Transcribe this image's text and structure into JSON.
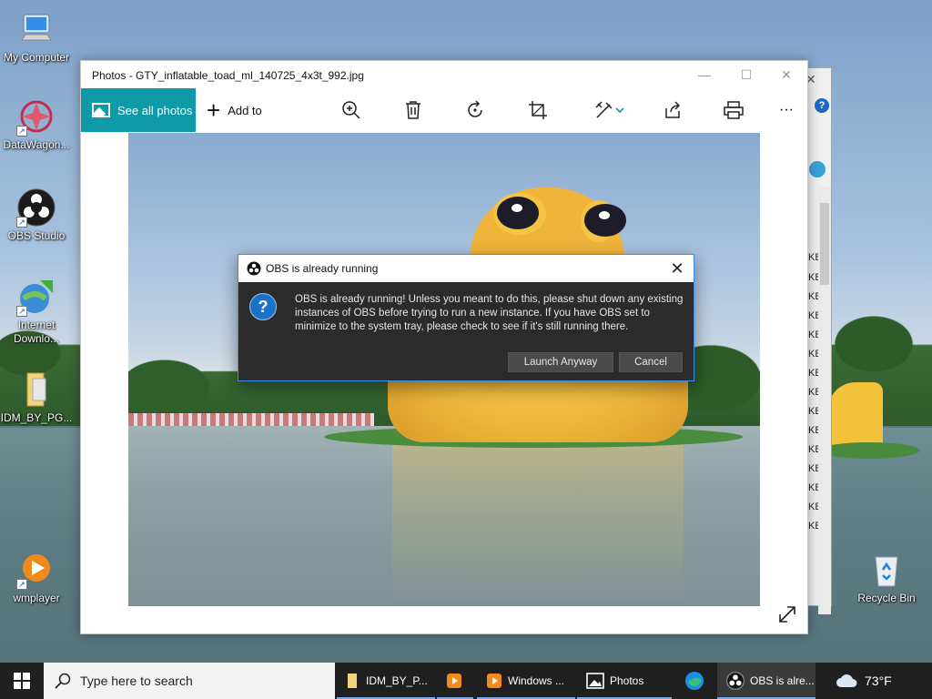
{
  "desktop": {
    "icons": [
      {
        "id": "my-computer",
        "label": "My Computer"
      },
      {
        "id": "datawagon",
        "label": "DataWagon..."
      },
      {
        "id": "obs-studio",
        "label": "OBS Studio"
      },
      {
        "id": "internet-download",
        "label": "Internet Downlo..."
      },
      {
        "id": "idm-folder",
        "label": "IDM_BY_PG..."
      },
      {
        "id": "wmplayer",
        "label": "wmplayer"
      },
      {
        "id": "recycle-bin",
        "label": "Recycle Bin"
      }
    ]
  },
  "back_window": {
    "help_label": "?",
    "size_unit": "KB"
  },
  "photos": {
    "title": "Photos - GTY_inflatable_toad_ml_140725_4x3t_992.jpg",
    "see_all_label": "See all photos",
    "add_to_label": "Add to",
    "toolbar_icons": [
      "zoom-in-icon",
      "delete-icon",
      "rotate-icon",
      "crop-icon",
      "edit-icon",
      "share-icon",
      "print-icon",
      "more-icon"
    ],
    "more_label": "···"
  },
  "dialog": {
    "title": "OBS is already running",
    "message": "OBS is already running! Unless you meant to do this, please shut down any existing instances of OBS before trying to run a new instance. If you have OBS set to minimize to the system tray, please check to see if it's still running there.",
    "icon_label": "?",
    "launch_label": "Launch Anyway",
    "cancel_label": "Cancel"
  },
  "taskbar": {
    "search_placeholder": "Type here to search",
    "apps": [
      {
        "label": "IDM_BY_P..."
      },
      {
        "label": ""
      },
      {
        "label": "Windows ..."
      },
      {
        "label": "Photos"
      },
      {
        "label": ""
      },
      {
        "label": "OBS is alre..."
      }
    ],
    "weather": "73°F"
  },
  "colors": {
    "photos_accent": "#0f9aa8",
    "dialog_bg": "#2b2b2b",
    "dialog_border": "#3e8ef0",
    "taskbar_bg": "#1f1f1f"
  }
}
